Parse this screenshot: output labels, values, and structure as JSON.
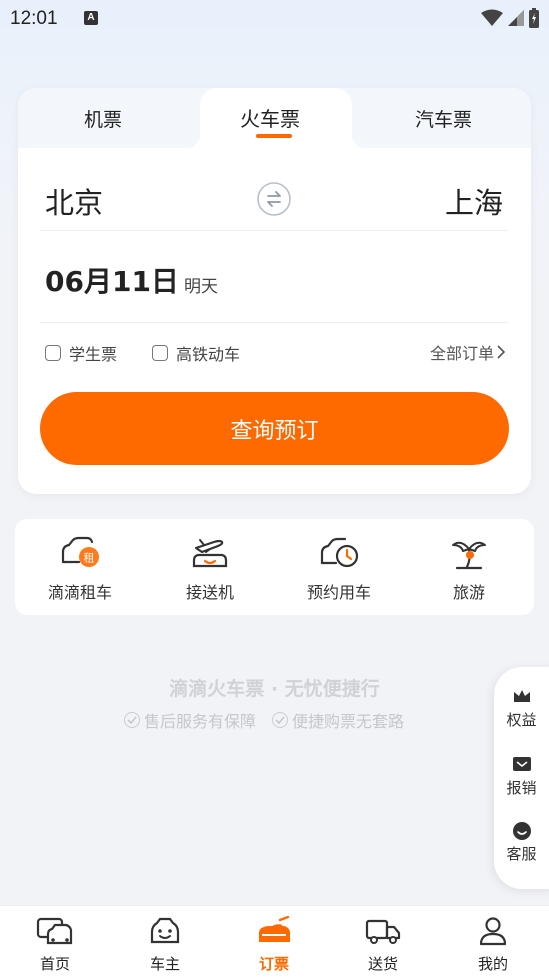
{
  "status_bar": {
    "time": "12:01",
    "a_badge": "A"
  },
  "tabs": [
    {
      "label": "机票"
    },
    {
      "label": "火车票"
    },
    {
      "label": "汽车票"
    }
  ],
  "route": {
    "from": "北京",
    "to": "上海"
  },
  "date": {
    "value": "06月11日",
    "hint": "明天"
  },
  "options": {
    "student": "学生票",
    "hsr": "高铁动车",
    "all_orders": "全部订单"
  },
  "search_button": "查询预订",
  "services": [
    {
      "label": "滴滴租车",
      "icon": "car-rental-icon"
    },
    {
      "label": "接送机",
      "icon": "airport-transfer-icon"
    },
    {
      "label": "预约用车",
      "icon": "scheduled-ride-icon"
    },
    {
      "label": "旅游",
      "icon": "travel-icon"
    }
  ],
  "slogan": {
    "title": "滴滴火车票 · 无忧便捷行",
    "feature1": "售后服务有保障",
    "feature2": "便捷购票无套路"
  },
  "float_panel": [
    {
      "label": "权益",
      "icon": "crown-icon"
    },
    {
      "label": "报销",
      "icon": "reimburse-icon"
    },
    {
      "label": "客服",
      "icon": "customer-service-icon"
    }
  ],
  "bottom_nav": [
    {
      "label": "首页",
      "icon": "home-icon"
    },
    {
      "label": "车主",
      "icon": "driver-icon"
    },
    {
      "label": "订票",
      "icon": "train-ticket-icon"
    },
    {
      "label": "送货",
      "icon": "delivery-truck-icon"
    },
    {
      "label": "我的",
      "icon": "profile-icon"
    }
  ],
  "colors": {
    "accent": "#ff6a00",
    "background": "#f2f3f7"
  }
}
